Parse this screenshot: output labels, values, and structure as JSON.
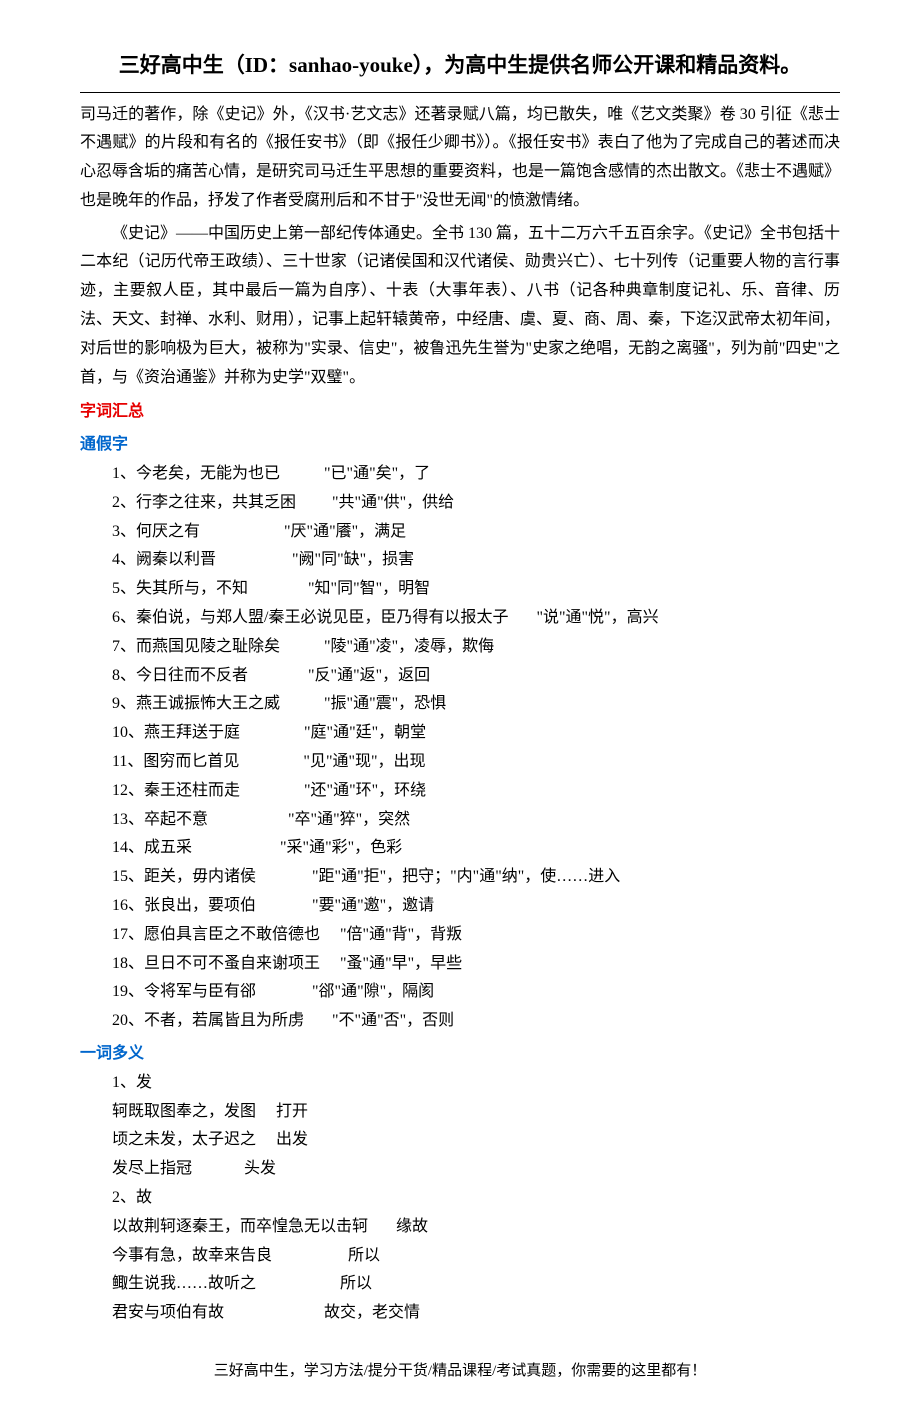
{
  "header": {
    "title": "三好高中生（ID：sanhao-youke），为高中生提供名师公开课和精品资料。"
  },
  "para1": "司马迁的著作，除《史记》外，《汉书·艺文志》还著录赋八篇，均已散失，唯《艺文类聚》卷 30 引征《悲士不遇赋》的片段和有名的《报任安书》（即《报任少卿书》）。《报任安书》表白了他为了完成自己的著述而决心忍辱含垢的痛苦心情，是研究司马迁生平思想的重要资料，也是一篇饱含感情的杰出散文。《悲士不遇赋》也是晚年的作品，抒发了作者受腐刑后和不甘于\"没世无闻\"的愤激情绪。",
  "para2": "《史记》——中国历史上第一部纪传体通史。全书 130 篇，五十二万六千五百余字。《史记》全书包括十二本纪（记历代帝王政绩）、三十世家（记诸侯国和汉代诸侯、勋贵兴亡）、七十列传（记重要人物的言行事迹，主要叙人臣，其中最后一篇为自序）、十表（大事年表）、八书（记各种典章制度记礼、乐、音律、历法、天文、封禅、水利、财用），记事上起轩辕黄帝，中经唐、虞、夏、商、周、秦，下迄汉武帝太初年间，对后世的影响极为巨大，被称为\"实录、信史\"，被鲁迅先生誉为\"史家之绝唱，无韵之离骚\"，列为前\"四史\"之首，与《资治通鉴》并称为史学\"双璧\"。",
  "sections": {
    "vocab_title": "字词汇总",
    "tongjia_title": "通假字",
    "polysemy_title": "一词多义"
  },
  "tongjia": [
    "1、今老矣，无能为也已           \"已\"通\"矣\"，了",
    "2、行李之往来，共其乏困         \"共\"通\"供\"，供给",
    "3、何厌之有                     \"厌\"通\"餍\"，满足",
    "4、阙秦以利晋                   \"阙\"同\"缺\"，损害",
    "5、失其所与，不知               \"知\"同\"智\"，明智",
    "6、秦伯说，与郑人盟/秦王必说见臣，臣乃得有以报太子       \"说\"通\"悦\"，高兴",
    "7、而燕国见陵之耻除矣           \"陵\"通\"凌\"，凌辱，欺侮",
    "8、今日往而不反者               \"反\"通\"返\"，返回",
    "9、燕王诚振怖大王之威           \"振\"通\"震\"，恐惧",
    "10、燕王拜送于庭                \"庭\"通\"廷\"，朝堂",
    "11、图穷而匕首见                \"见\"通\"现\"，出现",
    "12、秦王还柱而走                \"还\"通\"环\"，环绕",
    "13、卒起不意                    \"卒\"通\"猝\"，突然",
    "14、成五采                      \"采\"通\"彩\"，色彩",
    "15、距关，毋内诸侯              \"距\"通\"拒\"，把守；\"内\"通\"纳\"，使……进入",
    "16、张良出，要项伯              \"要\"通\"邀\"，邀请",
    "17、愿伯具言臣之不敢倍德也     \"倍\"通\"背\"，背叛",
    "18、旦日不可不蚤自来谢项王     \"蚤\"通\"早\"，早些",
    "19、令将军与臣有郤              \"郤\"通\"隙\"，隔阂",
    "20、不者，若属皆且为所虏       \"不\"通\"否\"，否则"
  ],
  "polysemy": [
    "1、发",
    "轲既取图奉之，发图     打开",
    "顷之未发，太子迟之     出发",
    "发尽上指冠             头发",
    "2、故",
    "以故荆轲逐秦王，而卒惶急无以击轲       缘故",
    "今事有急，故幸来告良                   所以",
    "鲰生说我……故听之                     所以",
    "君安与项伯有故                         故交，老交情"
  ],
  "footer": "三好高中生，学习方法/提分干货/精品课程/考试真题，你需要的这里都有！"
}
